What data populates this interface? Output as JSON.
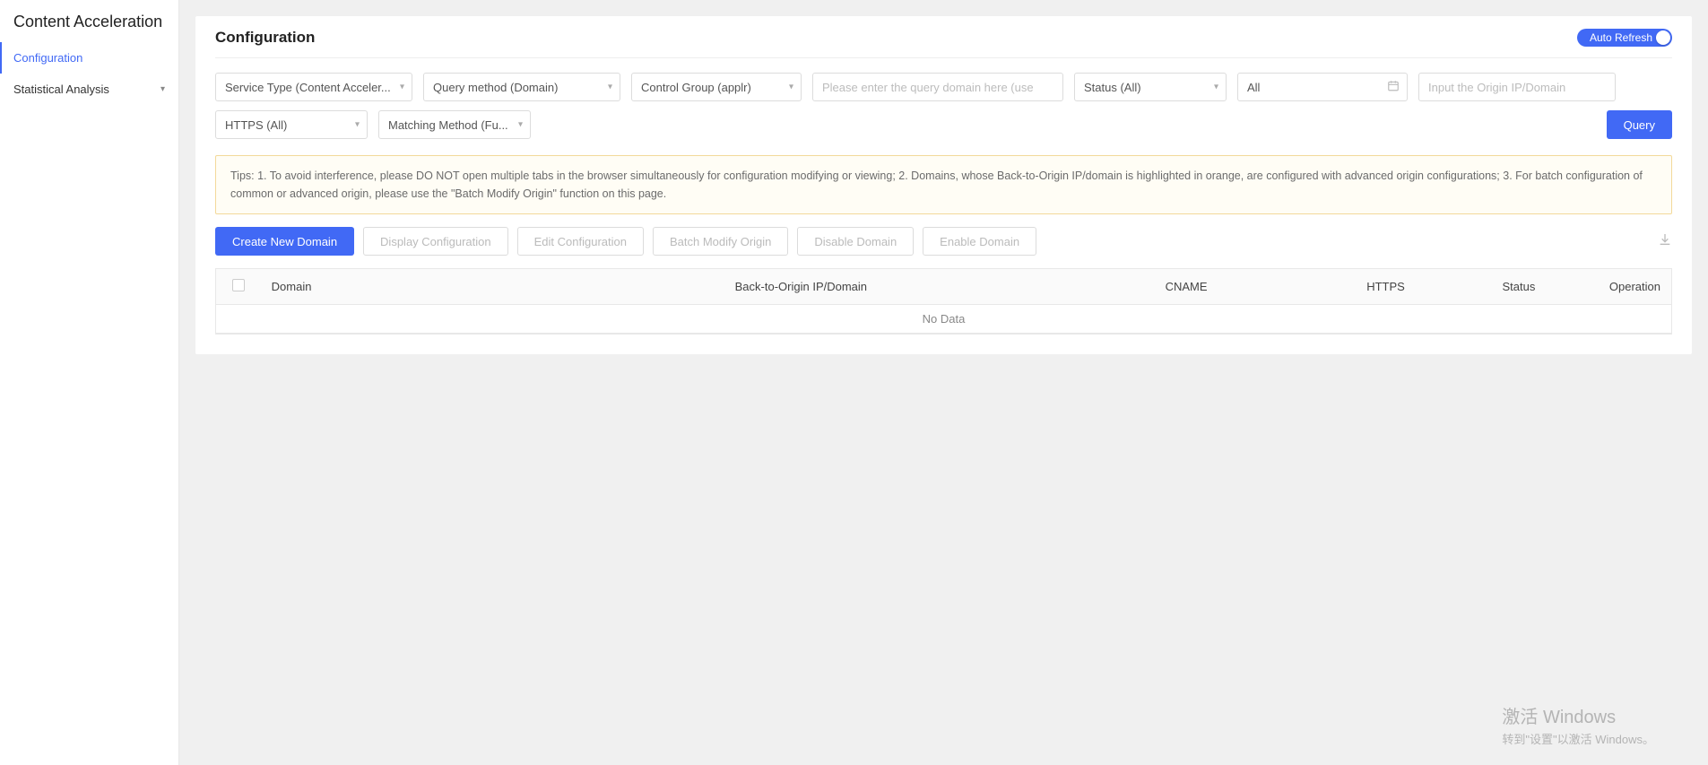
{
  "sidebar": {
    "title": "Content Acceleration",
    "items": [
      {
        "label": "Configuration",
        "active": true,
        "expandable": false
      },
      {
        "label": "Statistical Analysis",
        "active": false,
        "expandable": true
      }
    ]
  },
  "header": {
    "title": "Configuration",
    "auto_refresh_label": "Auto Refresh"
  },
  "filters": {
    "service_type": "Service Type (Content Acceler...",
    "query_method": "Query method (Domain)",
    "control_group": "Control Group (applr)",
    "query_domain_placeholder": "Please enter the query domain here (use ; to s",
    "status": "Status (All)",
    "date_value": "All",
    "origin_placeholder": "Input the Origin IP/Domain",
    "https": "HTTPS (All)",
    "matching_method": "Matching Method (Fu...",
    "query_button": "Query"
  },
  "tips": "Tips: 1. To avoid interference, please DO NOT open multiple tabs in the browser simultaneously for configuration modifying or viewing; 2. Domains, whose Back-to-Origin IP/domain is highlighted in orange, are configured with advanced origin configurations; 3. For batch configuration of common or advanced origin, please use the \"Batch Modify Origin\" function on this page.",
  "actions": {
    "create": "Create New Domain",
    "display": "Display Configuration",
    "edit": "Edit Configuration",
    "batch": "Batch Modify Origin",
    "disable": "Disable Domain",
    "enable": "Enable Domain"
  },
  "table": {
    "headers": {
      "domain": "Domain",
      "back_origin": "Back-to-Origin IP/Domain",
      "cname": "CNAME",
      "https": "HTTPS",
      "status": "Status",
      "operation": "Operation"
    },
    "empty": "No Data"
  },
  "watermark": {
    "title": "激活 Windows",
    "subtitle": "转到\"设置\"以激活 Windows。"
  }
}
